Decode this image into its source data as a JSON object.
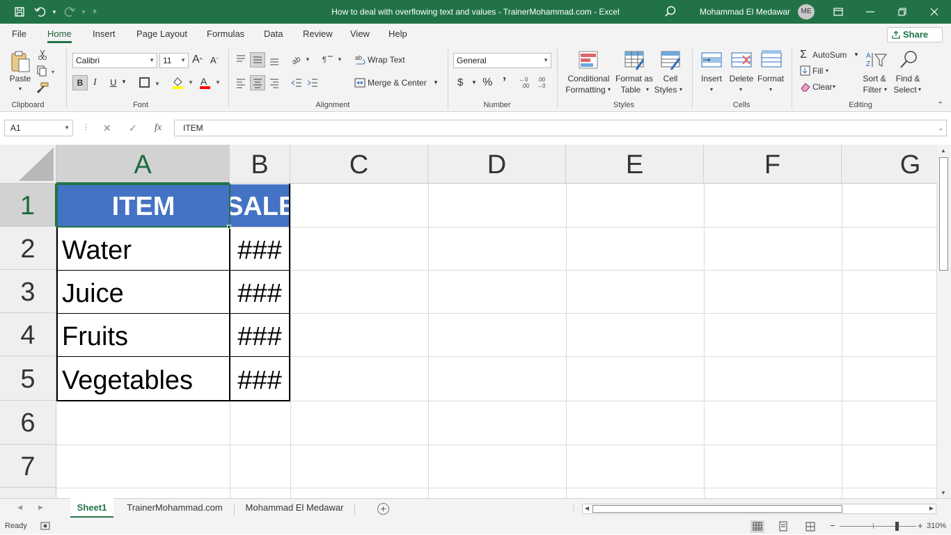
{
  "titlebar": {
    "title": "How to deal with overflowing text and values - TrainerMohammad.com  -  Excel",
    "user_name": "Mohammad El Medawar",
    "avatar_initials": "ME",
    "brand_color": "#217346"
  },
  "tabs": [
    "File",
    "Home",
    "Insert",
    "Page Layout",
    "Formulas",
    "Data",
    "Review",
    "View",
    "Help"
  ],
  "active_tab": "Home",
  "share_label": "Share",
  "ribbon": {
    "clipboard": {
      "paste": "Paste",
      "group": "Clipboard"
    },
    "font": {
      "name": "Calibri",
      "size": "11",
      "bold": "B",
      "italic": "I",
      "underline": "U",
      "group": "Font"
    },
    "alignment": {
      "wrap": "Wrap Text",
      "merge": "Merge & Center",
      "group": "Alignment"
    },
    "number": {
      "format": "General",
      "currency": "$",
      "percent": "%",
      "comma": "’",
      "group": "Number"
    },
    "styles": {
      "conditional_1": "Conditional",
      "conditional_2": "Formatting",
      "format_table_1": "Format as",
      "format_table_2": "Table",
      "cell_styles_1": "Cell",
      "cell_styles_2": "Styles",
      "group": "Styles"
    },
    "cells": {
      "insert": "Insert",
      "delete": "Delete",
      "format": "Format",
      "group": "Cells"
    },
    "editing": {
      "autosum": "AutoSum",
      "fill": "Fill",
      "clear": "Clear",
      "sort_1": "Sort &",
      "sort_2": "Filter",
      "find_1": "Find &",
      "find_2": "Select",
      "group": "Editing"
    }
  },
  "formula_bar": {
    "name_box": "A1",
    "fx": "fx",
    "formula": "ITEM"
  },
  "grid": {
    "columns": [
      "A",
      "B",
      "C",
      "D",
      "E",
      "F",
      "G"
    ],
    "rows": [
      "1",
      "2",
      "3",
      "4",
      "5",
      "6",
      "7"
    ],
    "header_fill": "#4472c4",
    "cells": {
      "A1": "ITEM",
      "B1": "SALES",
      "A2": "Water",
      "B2": "###",
      "A3": "Juice",
      "B3": "###",
      "A4": "Fruits",
      "B4": "###",
      "A5": "Vegetables",
      "B5": "###"
    }
  },
  "sheets": [
    "Sheet1",
    "TrainerMohammad.com",
    "Mohammad El Medawar"
  ],
  "active_sheet": "Sheet1",
  "status": {
    "mode": "Ready",
    "zoom": "310%"
  }
}
